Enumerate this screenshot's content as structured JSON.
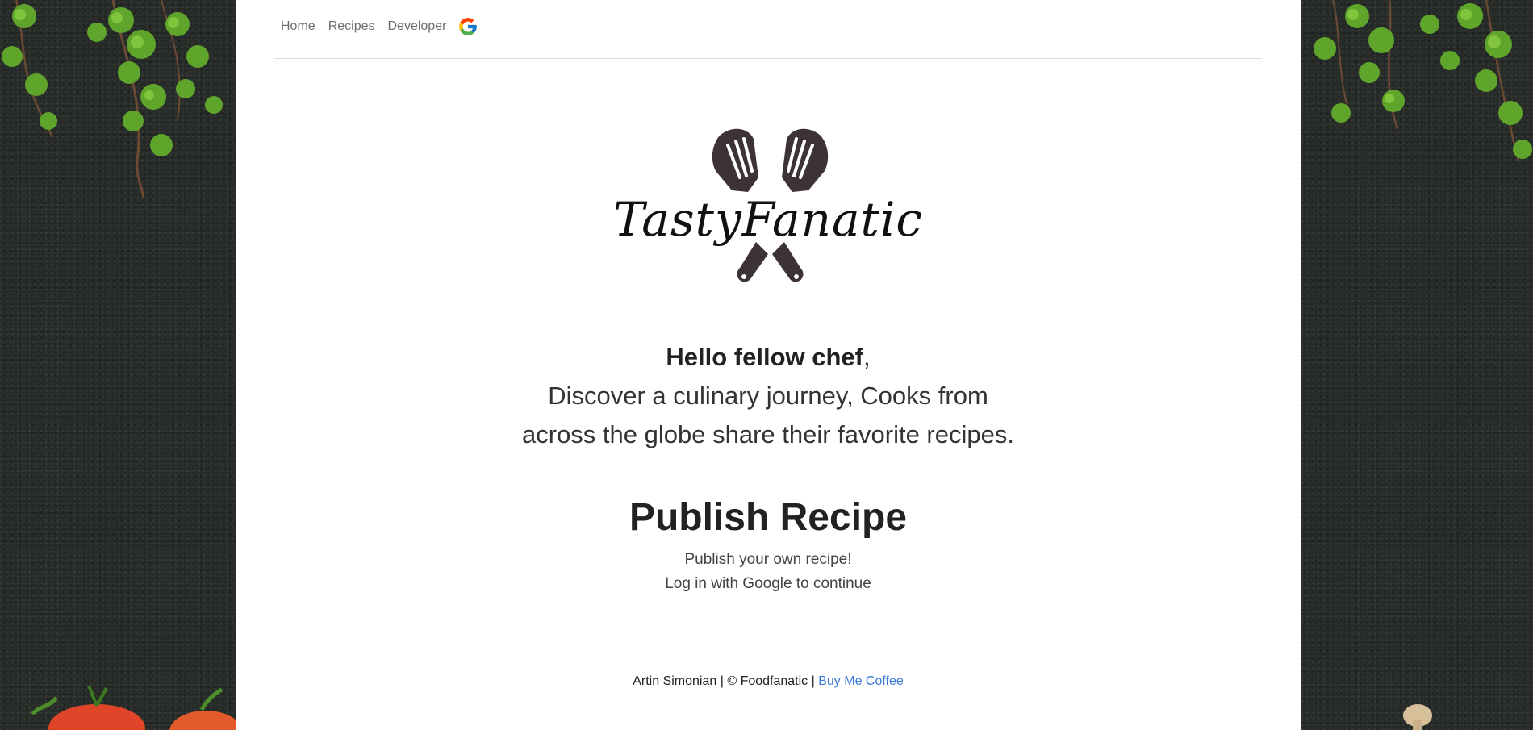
{
  "nav": {
    "items": [
      "Home",
      "Recipes",
      "Developer"
    ],
    "google_icon": "google-g-icon"
  },
  "logo": {
    "text": "TastyFanatic",
    "icon": "crossed-spatulas-icon"
  },
  "hero": {
    "greeting_bold": "Hello fellow chef",
    "greeting_punct": ",",
    "line1": "Discover a culinary journey, Cooks from",
    "line2": "across the globe share their favorite recipes."
  },
  "publish": {
    "title": "Publish Recipe",
    "line1": "Publish your own recipe!",
    "line2": "Log in with Google to continue"
  },
  "footer": {
    "text": "Artin Simonian | © Foodfanatic | ",
    "link": "Buy Me Coffee"
  },
  "colors": {
    "side_bg": "#262a27",
    "link": "#3b78d8",
    "ivy": "#5fa52c"
  }
}
